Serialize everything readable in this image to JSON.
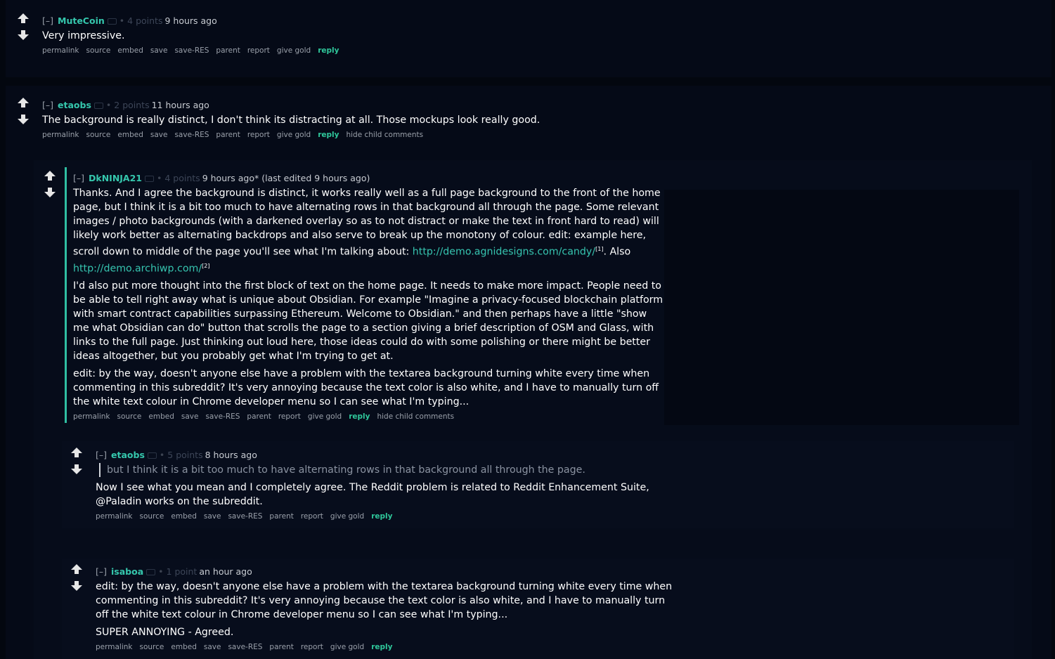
{
  "comments": [
    {
      "collapse": "[–]",
      "author": "MuteCoin",
      "score": "4 points",
      "time": "9 hours ago",
      "edited": "",
      "paragraphs": [
        "Very impressive."
      ],
      "buttons": [
        "permalink",
        "source",
        "embed",
        "save",
        "save-RES",
        "parent",
        "report",
        "give gold"
      ],
      "reply": "reply",
      "hide": ""
    },
    {
      "collapse": "[–]",
      "author": "etaobs",
      "score": "2 points",
      "time": "11 hours ago",
      "edited": "",
      "paragraphs": [
        "The background is really distinct, I don't think its distracting at all. Those mockups look really good."
      ],
      "buttons": [
        "permalink",
        "source",
        "embed",
        "save",
        "save-RES",
        "parent",
        "report",
        "give gold"
      ],
      "reply": "reply",
      "hide": "hide child comments"
    },
    {
      "collapse": "[–]",
      "author": "DkNINJA21",
      "score": "4 points",
      "time": "9 hours ago*",
      "edited": "(last edited 9 hours ago)",
      "p1_text": "Thanks. And I agree the background is distinct, it works really well as a full page background to the front of the home page, but I think it is a bit too much to have alternating rows in that background all through the page. Some relevant images / photo backgrounds (with a darkened overlay so as to not distract or make the text in front hard to read) will likely work better as alternating backdrops and also serve to break up the monotony of colour. edit: example here, scroll down to middle of the page you'll see what I'm talking about: ",
      "link1": "http://demo.agnidesigns.com/candy/",
      "sup1": "[1]",
      "also": ". Also",
      "link2": "http://demo.archiwp.com/",
      "sup2": "[2]",
      "paragraphs": [
        "I'd also put more thought into the first block of text on the home page. It needs to make more impact. People need to be able to tell right away what is unique about Obsidian. For example \"Imagine a privacy-focused blockchain platform with smart contract capabilities surpassing Ethereum. Welcome to Obsidian.\" and then perhaps have a little \"show me what Obsidian can do\" button that scrolls the page to a section giving a brief description of OSM and Glass, with links to the full page. Just thinking out loud here, those ideas could do with some polishing or there might be better ideas altogether, but you probably get what I'm trying to get at.",
        "edit: by the way, doesn't anyone else have a problem with the textarea background turning white every time when commenting in this subreddit? It's very annoying because the text color is also white, and I have to manually turn off the white text colour in Chrome developer menu so I can see what I'm typing..."
      ],
      "buttons": [
        "permalink",
        "source",
        "embed",
        "save",
        "save-RES",
        "parent",
        "report",
        "give gold"
      ],
      "reply": "reply",
      "hide": "hide child comments"
    },
    {
      "collapse": "[–]",
      "author": "etaobs",
      "score": "5 points",
      "time": "8 hours ago",
      "edited": "",
      "quote": "but I think it is a bit too much to have alternating rows in that background all through the page.",
      "paragraphs": [
        "Now I see what you mean and I completely agree. The Reddit problem is related to Reddit Enhancement Suite, @Paladin works on the subreddit."
      ],
      "buttons": [
        "permalink",
        "source",
        "embed",
        "save",
        "save-RES",
        "parent",
        "report",
        "give gold"
      ],
      "reply": "reply",
      "hide": ""
    },
    {
      "collapse": "[–]",
      "author": "isaboa",
      "score": "1 point",
      "time": "an hour ago",
      "edited": "",
      "paragraphs": [
        "edit: by the way, doesn't anyone else have a problem with the textarea background turning white every time when commenting in this subreddit? It's very annoying because the text color is also white, and I have to manually turn off the white text colour in Chrome developer menu so I can see what I'm typing...",
        "SUPER ANNOYING - Agreed."
      ],
      "buttons": [
        "permalink",
        "source",
        "embed",
        "save",
        "save-RES",
        "parent",
        "report",
        "give gold"
      ],
      "reply": "reply",
      "hide": ""
    }
  ],
  "icons": {
    "upvote": "up-arrow-icon",
    "downvote": "down-arrow-icon",
    "flair": "flair-icon"
  },
  "colors": {
    "background": "#03070f",
    "accent": "#35c7ad",
    "reply": "#2fc79b"
  }
}
